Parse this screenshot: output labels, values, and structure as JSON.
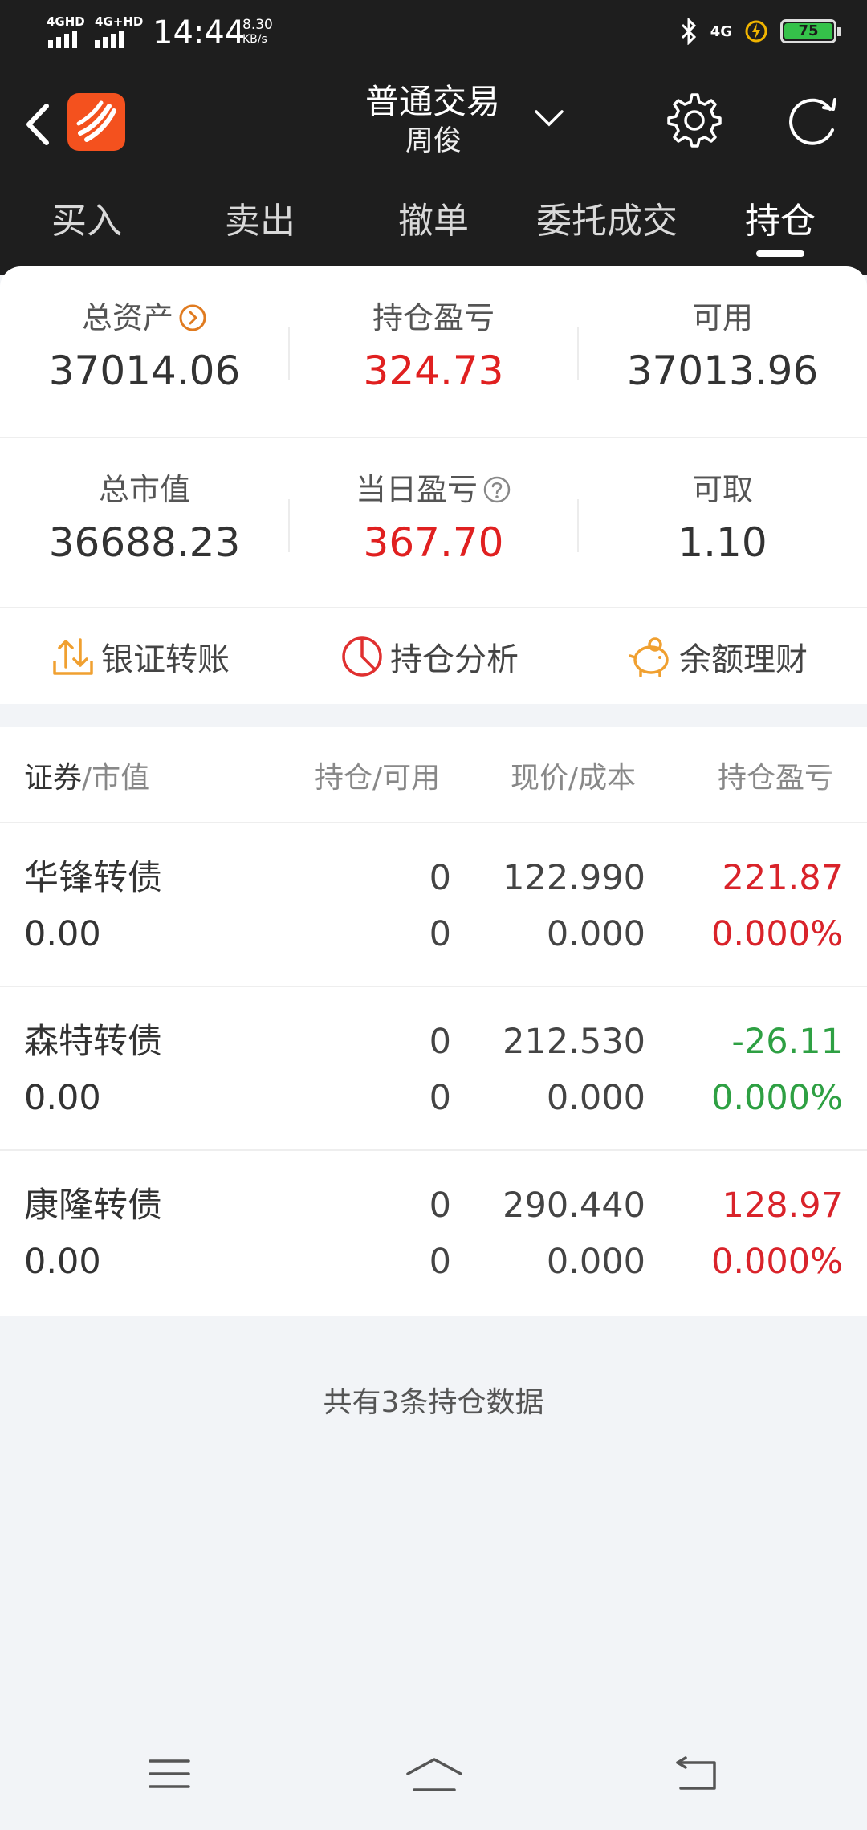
{
  "status_bar": {
    "net1": "4GHD",
    "net2": "4G+HD",
    "time": "14:44",
    "speed_value": "8.30",
    "speed_unit": "KB/s",
    "net3": "4G",
    "battery": "75"
  },
  "header": {
    "title": "普通交易",
    "subtitle": "周俊"
  },
  "tabs": [
    {
      "label": "买入"
    },
    {
      "label": "卖出"
    },
    {
      "label": "撤单"
    },
    {
      "label": "委托成交"
    },
    {
      "label": "持仓"
    }
  ],
  "summary": {
    "total_assets_label": "总资产",
    "total_assets": "37014.06",
    "position_pnl_label": "持仓盈亏",
    "position_pnl": "324.73",
    "available_label": "可用",
    "available": "37013.96",
    "market_value_label": "总市值",
    "market_value": "36688.23",
    "daily_pnl_label": "当日盈亏",
    "daily_pnl": "367.70",
    "withdrawable_label": "可取",
    "withdrawable": "1.10"
  },
  "actions": {
    "bank_transfer": "银证转账",
    "position_analysis": "持仓分析",
    "balance_finance": "余额理财"
  },
  "list": {
    "header": {
      "security": "证券",
      "market_value": "/市值",
      "position": "持仓/可用",
      "price": "现价/成本",
      "pnl": "持仓盈亏"
    },
    "rows": [
      {
        "name": "华锋转债",
        "mv": "0.00",
        "qty": "0",
        "avail": "0",
        "price": "122.990",
        "cost": "0.000",
        "pnl": "221.87",
        "pct": "0.000%"
      },
      {
        "name": "森特转债",
        "mv": "0.00",
        "qty": "0",
        "avail": "0",
        "price": "212.530",
        "cost": "0.000",
        "pnl": "-26.11",
        "pct": "0.000%"
      },
      {
        "name": "康隆转债",
        "mv": "0.00",
        "qty": "0",
        "avail": "0",
        "price": "290.440",
        "cost": "0.000",
        "pnl": "128.97",
        "pct": "0.000%"
      }
    ],
    "footer": "共有3条持仓数据"
  },
  "colors": {
    "dark_bg": "#1e1e1e",
    "profit_red": "#d9232a",
    "loss_green": "#2ea043",
    "brand_orange": "#f4511e",
    "accent_orange": "#f0a030"
  }
}
